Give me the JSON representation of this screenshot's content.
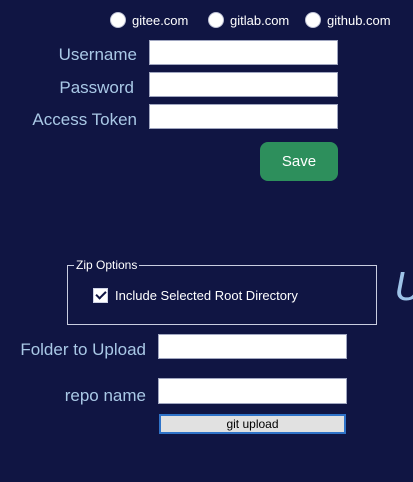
{
  "hosts": {
    "options": [
      {
        "label": "gitee.com"
      },
      {
        "label": "gitlab.com"
      },
      {
        "label": "github.com"
      }
    ]
  },
  "credentials": {
    "username_label": "Username",
    "username_value": "",
    "password_label": "Password",
    "password_value": "",
    "token_label": "Access Token",
    "token_value": "",
    "save_label": "Save"
  },
  "zip": {
    "legend": "Zip Options",
    "include_root_label": "Include Selected Root Directory",
    "include_root_checked": true
  },
  "upload": {
    "folder_label": "Folder to Upload",
    "folder_value": "",
    "repo_label": "repo name",
    "repo_value": "",
    "button_label": "git upload"
  },
  "partial_text": "U",
  "colors": {
    "background": "#101543",
    "label": "#a9c8e6",
    "save_button": "#2d8f5c",
    "button_border": "#2f73c8"
  }
}
